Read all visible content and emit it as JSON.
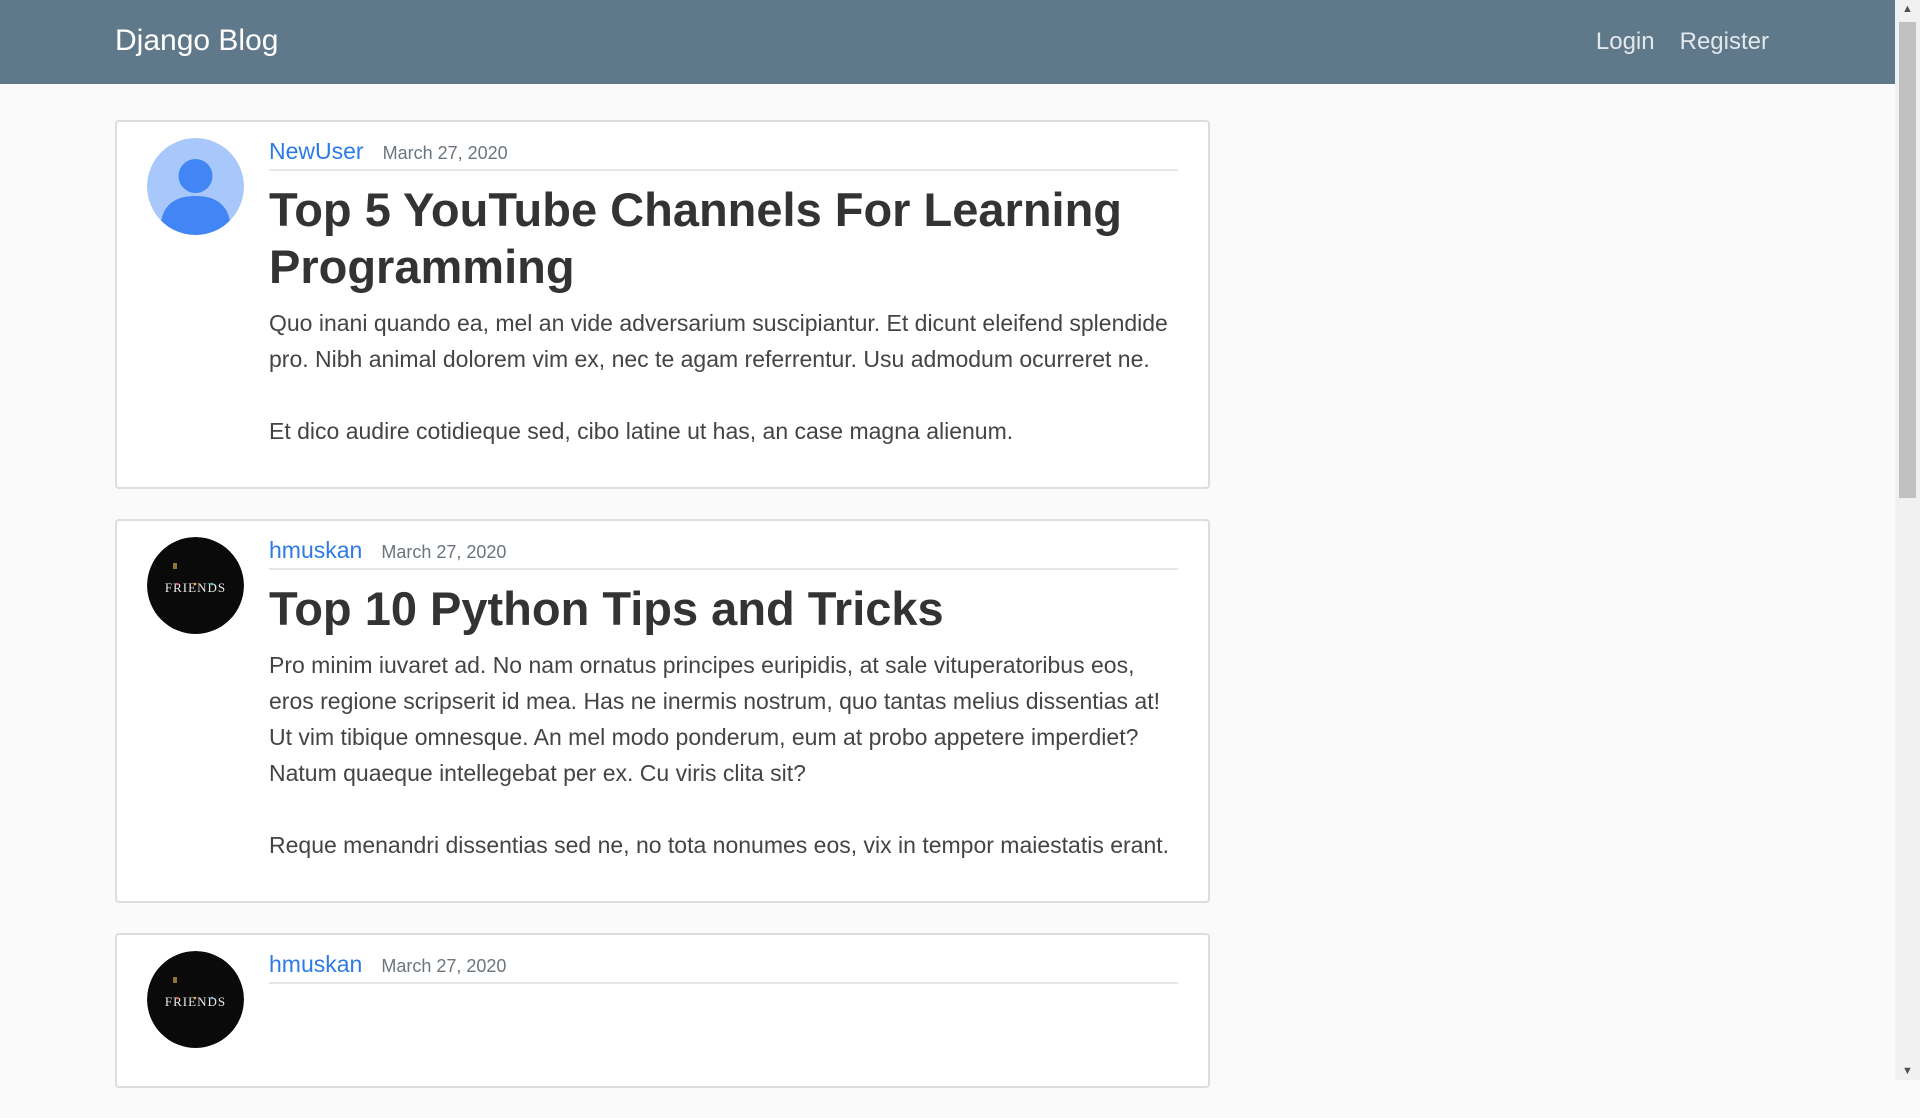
{
  "navbar": {
    "brand": "Django Blog",
    "links": [
      "Login",
      "Register"
    ]
  },
  "posts": [
    {
      "author": "NewUser",
      "date": "March 27, 2020",
      "title": "Top 5 YouTube Channels For Learning Programming",
      "paragraphs": [
        "Quo inani quando ea, mel an vide adversarium suscipiantur. Et dicunt eleifend splendide pro. Nibh animal dolorem vim ex, nec te agam referrentur. Usu admodum ocurreret ne.",
        "Et dico audire cotidieque sed, cibo latine ut has, an case magna alienum."
      ]
    },
    {
      "author": "hmuskan",
      "date": "March 27, 2020",
      "title": "Top 10 Python Tips and Tricks",
      "paragraphs": [
        "Pro minim iuvaret ad. No nam ornatus principes euripidis, at sale vituperatoribus eos, eros regione scripserit id mea. Has ne inermis nostrum, quo tantas melius dissentias at! Ut vim tibique omnesque. An mel modo ponderum, eum at probo appetere imperdiet? Natum quaeque intellegebat per ex. Cu viris clita sit?",
        "Reque menandri dissentias sed ne, no tota nonumes eos, vix in tempor maiestatis erant."
      ]
    },
    {
      "author": "hmuskan",
      "date": "March 27, 2020",
      "title": "",
      "paragraphs": []
    }
  ],
  "avatars": {
    "default_user": {
      "icon": "person-silhouette-icon",
      "background": "#a8c7fa",
      "figure": "#4285f4"
    },
    "friends_logo": {
      "icon": "friends-logo-icon",
      "text": "FRIENDS",
      "background": "#0a0a0a"
    }
  },
  "colors": {
    "navbar": "#5f788a",
    "link": "#2c7be5",
    "page_background": "#fafafa"
  }
}
